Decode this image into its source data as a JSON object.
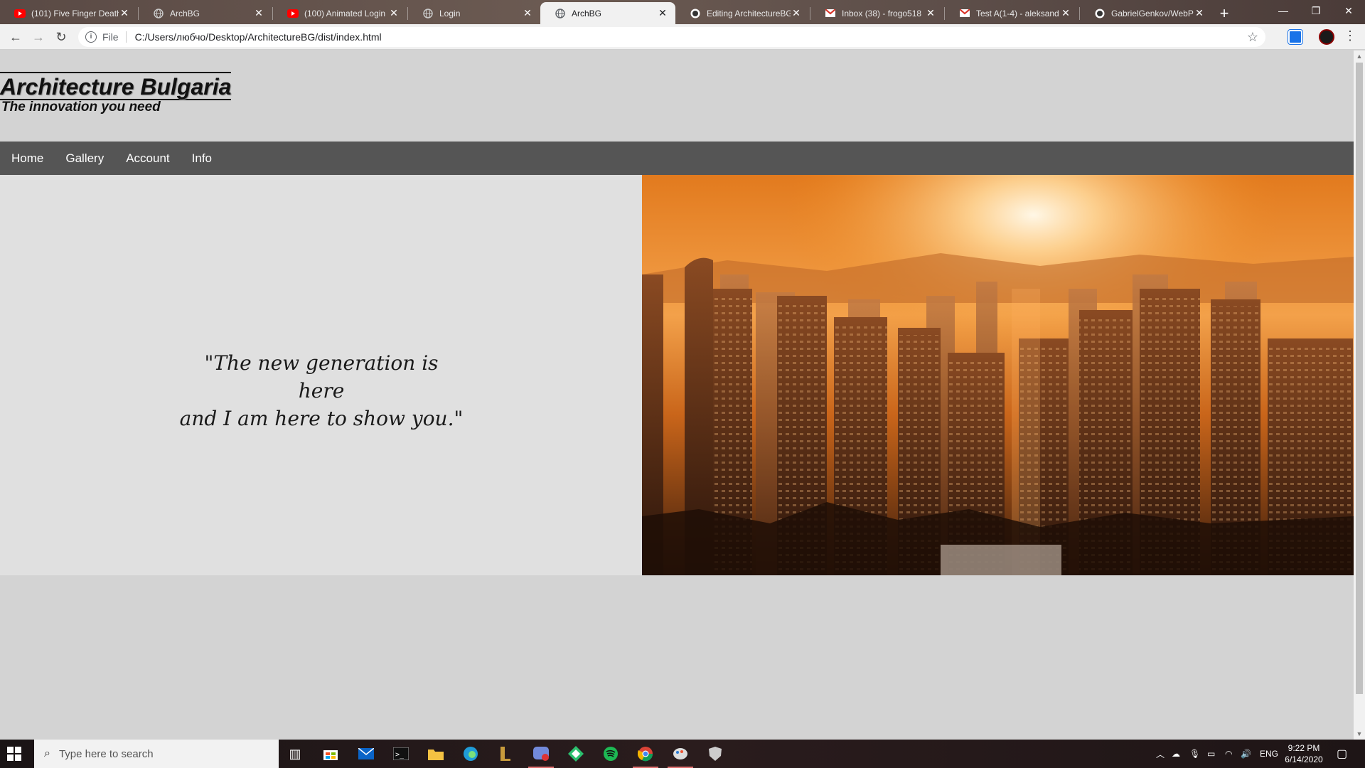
{
  "browser": {
    "tabs": [
      {
        "title": "(101) Five Finger Death",
        "icon": "youtube-icon",
        "active": false
      },
      {
        "title": "ArchBG",
        "icon": "globe-icon",
        "active": false
      },
      {
        "title": "(100) Animated Login F",
        "icon": "youtube-icon",
        "active": false
      },
      {
        "title": "Login",
        "icon": "globe-icon",
        "active": false
      },
      {
        "title": "ArchBG",
        "icon": "globe-icon",
        "active": true
      },
      {
        "title": "Editing ArchitectureBG",
        "icon": "github-icon",
        "active": false
      },
      {
        "title": "Inbox (38) - frogo518",
        "icon": "gmail-icon",
        "active": false
      },
      {
        "title": "Test A(1-4) - aleksand",
        "icon": "gmail-icon",
        "active": false
      },
      {
        "title": "GabrielGenkov/WebP",
        "icon": "github-icon",
        "active": false
      }
    ],
    "address": {
      "scheme_label": "File",
      "url": "C:/Users/любчо/Desktop/ArchitectureBG/dist/index.html"
    }
  },
  "site": {
    "title": "Architecture Bulgaria",
    "tagline": "The innovation you need",
    "nav": [
      "Home",
      "Gallery",
      "Account",
      "Info"
    ],
    "quote_line1": "\"The new generation is here",
    "quote_line2": "and I am here to show you.\""
  },
  "taskbar": {
    "search_placeholder": "Type here to search",
    "language": "ENG",
    "time": "9:22 PM",
    "date": "6/14/2020"
  },
  "colors": {
    "page_bg": "#d3d3d3",
    "hero_bg": "#e0e0e0",
    "nav_bg": "#555555",
    "sunset_orange": "#f08a1c"
  }
}
